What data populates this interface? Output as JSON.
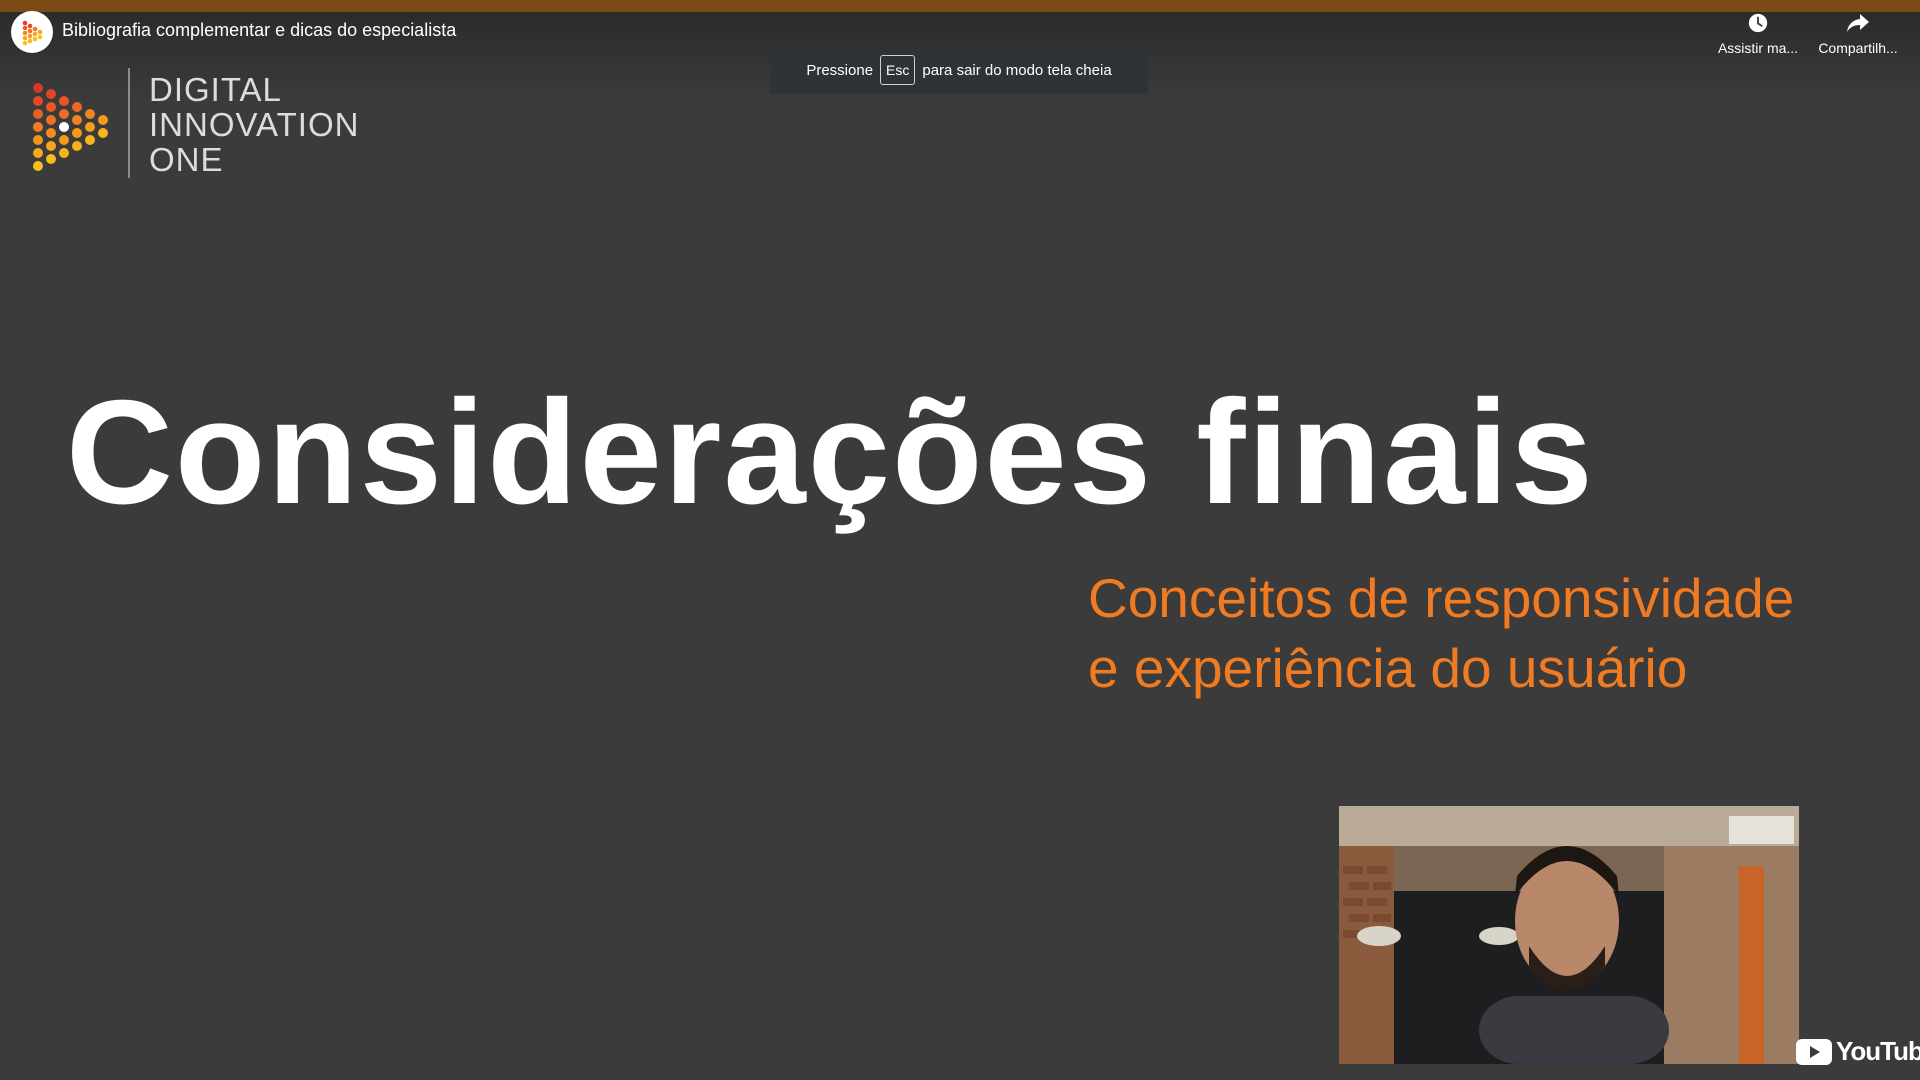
{
  "player": {
    "title": "Bibliografia complementar e dicas do especialista",
    "channel_icon": "diome-play-logo-icon",
    "actions": {
      "watch_later": {
        "label": "Assistir ma...",
        "icon": "clock-icon"
      },
      "share": {
        "label": "Compartilh...",
        "icon": "share-arrow-icon"
      }
    },
    "fullscreen_toast": {
      "before": "Pressione",
      "key": "Esc",
      "after": "para sair do modo tela cheia"
    },
    "watermark": {
      "label": "YouTube",
      "icon": "youtube-play-icon"
    }
  },
  "slide": {
    "brand": {
      "line1": "DIGITAL",
      "line2": "INNOVATION",
      "line3": "ONE"
    },
    "title": "Considerações finais",
    "subtitle_line1": "Conceitos de responsividade",
    "subtitle_line2": "e experiência do usuário"
  },
  "colors": {
    "background": "#3b3b3b",
    "subtitle": "#f07b22",
    "top_accent": "#7a4a17"
  }
}
